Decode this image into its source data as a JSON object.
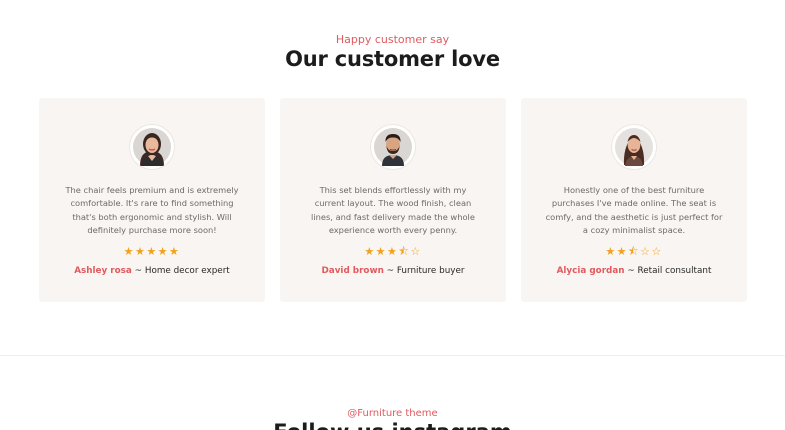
{
  "section": {
    "eyebrow": "Happy customer say",
    "title": "Our customer love"
  },
  "testimonials": [
    {
      "quote": "The chair feels premium and is extremely comfortable. It's rare to find something that's both ergonomic and stylish. Will definitely purchase more soon!",
      "rating": 5,
      "stars": "★★★★★",
      "name": "Ashley rosa",
      "separator": "~",
      "role": "Home decor expert",
      "avatar_icon": "woman-avatar"
    },
    {
      "quote": "This set blends effortlessly with my current layout. The wood finish, clean lines, and fast delivery made the whole experience worth every penny.",
      "rating": 3.5,
      "stars": "★★★⯪☆",
      "name": "David brown",
      "separator": "~",
      "role": "Furniture buyer",
      "avatar_icon": "man-avatar"
    },
    {
      "quote": "Honestly one of the best furniture purchases I've made online. The seat is comfy, and the aesthetic is just perfect for a cozy minimalist space.",
      "rating": 2.5,
      "stars": "★★⯪☆☆",
      "name": "Alycia gordan",
      "separator": "~",
      "role": "Retail consultant",
      "avatar_icon": "woman-avatar"
    }
  ],
  "next_section": {
    "eyebrow": "@Furniture theme",
    "title": "Follow us instagram"
  },
  "colors": {
    "accent": "#e05a5f",
    "star": "#f2a11b",
    "card_bg": "#f8f5f2"
  }
}
